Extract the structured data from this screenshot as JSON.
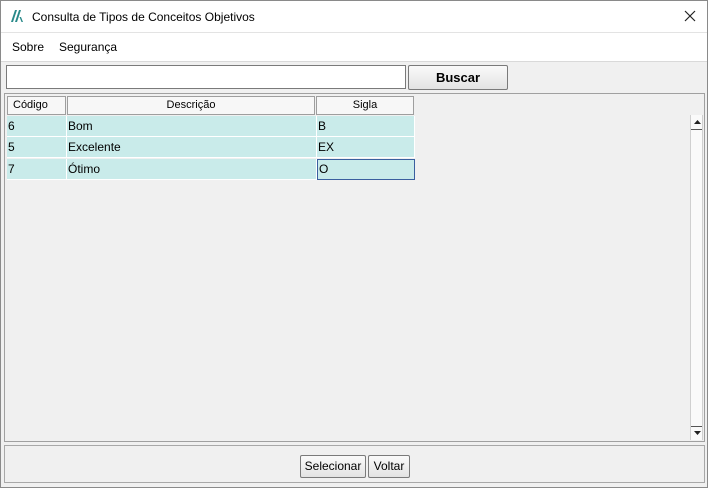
{
  "window": {
    "title": "Consulta de Tipos de Conceitos Objetivos",
    "app_icon": "app-logo-icon",
    "close_icon": "close-icon"
  },
  "menu": {
    "items": [
      {
        "label": "Sobre"
      },
      {
        "label": "Segurança"
      }
    ]
  },
  "search": {
    "value": "",
    "button_label": "Buscar"
  },
  "table": {
    "columns": [
      "Código",
      "Descrição",
      "Sigla"
    ],
    "rows": [
      {
        "codigo": "6",
        "descricao": "Bom",
        "sigla": "B"
      },
      {
        "codigo": "5",
        "descricao": "Excelente",
        "sigla": "EX"
      },
      {
        "codigo": "7",
        "descricao": "Ótimo",
        "sigla": "O"
      }
    ],
    "selected_row": 2,
    "row_color": "#c9ebea"
  },
  "footer": {
    "select_label": "Selecionar",
    "back_label": "Voltar"
  },
  "colors": {
    "accent_logo": "#2a8a8a",
    "selection_border": "#3a5f9f"
  }
}
